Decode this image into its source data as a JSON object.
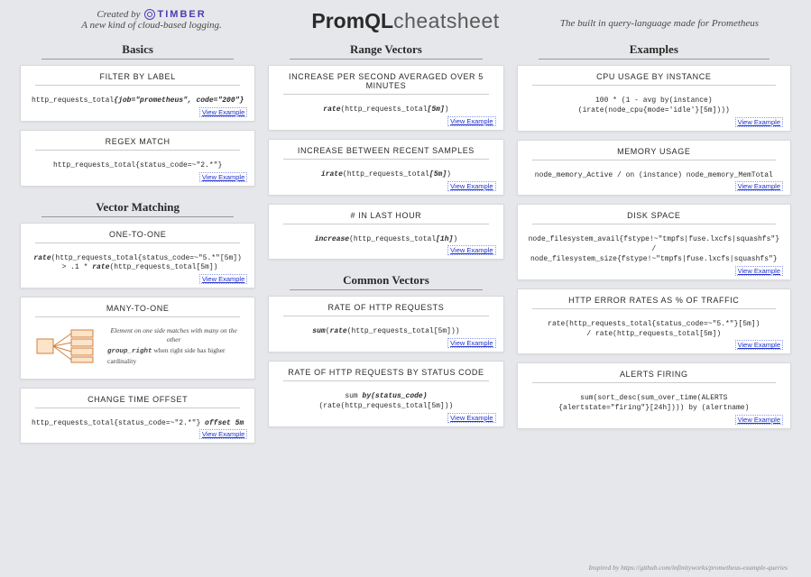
{
  "header": {
    "created_by_prefix": "Created by",
    "timber_brand": "TIMBER",
    "tagline_left": "A new kind of cloud-based logging.",
    "title_bold": "PromQL",
    "title_light": "cheatsheet",
    "tagline_right": "The built in query-language made for Prometheus"
  },
  "link_label": "View Example",
  "footer": "Inspired by https://github.com/infinityworks/prometheus-example-queries",
  "sections": {
    "basics": {
      "title": "Basics"
    },
    "vector_matching": {
      "title": "Vector Matching"
    },
    "range_vectors": {
      "title": "Range Vectors"
    },
    "common_vectors": {
      "title": "Common Vectors"
    },
    "examples": {
      "title": "Examples"
    }
  },
  "cards": {
    "filter_by_label": {
      "title": "FILTER BY LABEL",
      "code_plain": "http_requests_total",
      "code_bold": "{job=\"prometheus\", code=\"200\"}"
    },
    "regex_match": {
      "title": "REGEX MATCH",
      "code": "http_requests_total{status_code=~\"2.*\"}"
    },
    "one_to_one": {
      "title": "ONE-TO-ONE",
      "code_l1_bold": "rate",
      "code_l1_rest": "(http_requests_total{status_code=~\"5.*\"[5m])",
      "code_l2_plain": " > .1 * ",
      "code_l2_bold": "rate",
      "code_l2_rest": "(http_requests_total[5m])"
    },
    "many_to_one": {
      "title": "MANY-TO-ONE",
      "tagline": "Element on one side matches with many on the other",
      "pre": "",
      "kw": "group_right",
      "post": " when right side has higher cardinality"
    },
    "time_offset": {
      "title": "CHANGE TIME OFFSET",
      "code_plain": "http_requests_total{status_code=~\"2.*\"} ",
      "code_bold": "offset 5m"
    },
    "rate_5m": {
      "title": "INCREASE PER SECOND AVERAGED OVER 5 MINUTES",
      "code_bold": "rate",
      "code_mid": "(http_requests_total",
      "code_bold2": "[5m]",
      "code_end": ")"
    },
    "irate": {
      "title": "INCREASE BETWEEN RECENT SAMPLES",
      "code_bold": "irate",
      "code_mid": "(http_requests_total",
      "code_bold2": "[5m]",
      "code_end": ")"
    },
    "increase_1h": {
      "title": "# IN LAST HOUR",
      "code_bold": "increase",
      "code_mid": "(http_requests_total",
      "code_bold2": "[1h]",
      "code_end": ")"
    },
    "rate_http": {
      "title": "RATE OF HTTP REQUESTS",
      "code_bold": "sum",
      "code_mid": "(",
      "code_bold2": "rate",
      "code_rest": "(http_requests_total[5m]))"
    },
    "rate_by_code": {
      "title": "RATE OF HTTP REQUESTS BY STATUS CODE",
      "code_pre": "sum ",
      "code_bold": "by(status_code)",
      "code_rest": " (rate(http_requests_total[5m]))"
    },
    "cpu": {
      "title": "CPU USAGE BY INSTANCE",
      "code": "100 * (1 - avg by(instance)\n(irate(node_cpu{mode='idle'}[5m])))"
    },
    "memory": {
      "title": "MEMORY USAGE",
      "code": "node_memory_Active / on (instance) node_memory_MemTotal"
    },
    "disk": {
      "title": "DISK SPACE",
      "code": "node_filesystem_avail{fstype!~\"tmpfs|fuse.lxcfs|squashfs\"} /\nnode_filesystem_size{fstype!~\"tmpfs|fuse.lxcfs|squashfs\"}"
    },
    "http_err": {
      "title": "HTTP ERROR RATES AS % OF TRAFFIC",
      "code": "rate(http_requests_total{status_code=~\"5.*\"}[5m])\n/ rate(http_requests_total[5m])"
    },
    "alerts": {
      "title": "ALERTS FIRING",
      "code": "sum(sort_desc(sum_over_time(ALERTS\n{alertstate=\"firing\"}[24h]))) by (alertname)"
    }
  }
}
